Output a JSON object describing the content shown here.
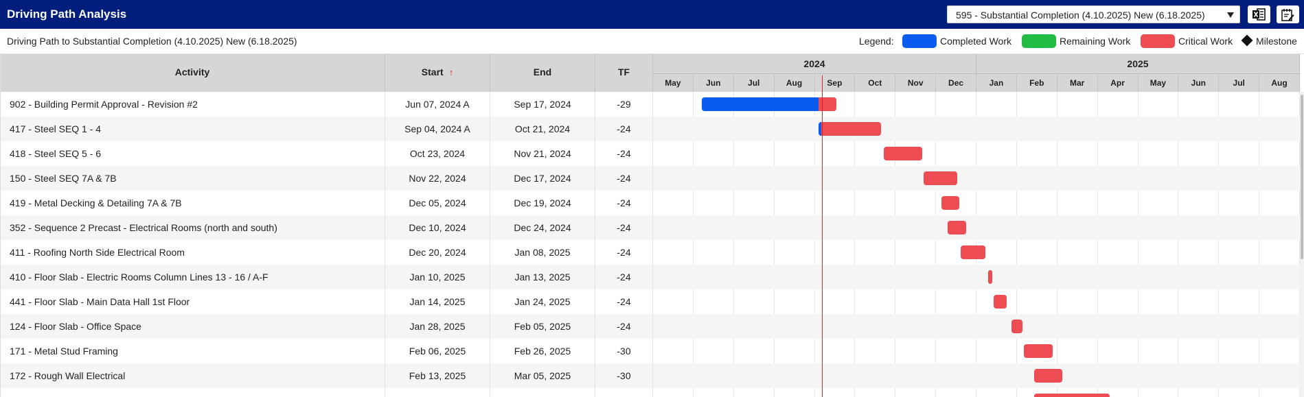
{
  "header": {
    "title": "Driving Path Analysis",
    "scenario_selected": "595 - Substantial Completion (4.10.2025) New (6.18.2025)",
    "excel_icon": "excel-export-icon",
    "notes_icon": "edit-notes-icon"
  },
  "subheader": {
    "path_label": "Driving Path to Substantial Completion (4.10.2025) New (6.18.2025)",
    "legend_label": "Legend:",
    "legend": [
      {
        "label": "Completed Work",
        "color": "#0a5cf0"
      },
      {
        "label": "Remaining Work",
        "color": "#22bb44"
      },
      {
        "label": "Critical Work",
        "color": "#ec4c52"
      },
      {
        "label": "Milestone",
        "color": "#111111"
      }
    ]
  },
  "table": {
    "columns": {
      "activity": "Activity",
      "start": "Start",
      "end": "End",
      "tf": "TF"
    },
    "sort_indicator": "↑",
    "rows": [
      {
        "activity": "902 - Building Permit Approval - Revision #2",
        "start": "Jun 07, 2024 A",
        "end": "Sep 17, 2024",
        "tf": "-29",
        "start_date": "2024-06-07",
        "end_date": "2024-09-17",
        "completed_until": "2024-09-04"
      },
      {
        "activity": "417 - Steel SEQ 1 - 4",
        "start": "Sep 04, 2024 A",
        "end": "Oct 21, 2024",
        "tf": "-24",
        "start_date": "2024-09-04",
        "end_date": "2024-10-21",
        "completed_until": "2024-09-06"
      },
      {
        "activity": "418 - Steel SEQ 5 - 6",
        "start": "Oct 23, 2024",
        "end": "Nov 21, 2024",
        "tf": "-24",
        "start_date": "2024-10-23",
        "end_date": "2024-11-21"
      },
      {
        "activity": "150 - Steel SEQ 7A & 7B",
        "start": "Nov 22, 2024",
        "end": "Dec 17, 2024",
        "tf": "-24",
        "start_date": "2024-11-22",
        "end_date": "2024-12-17"
      },
      {
        "activity": "419 - Metal Decking & Detailing 7A & 7B",
        "start": "Dec 05, 2024",
        "end": "Dec 19, 2024",
        "tf": "-24",
        "start_date": "2024-12-05",
        "end_date": "2024-12-19"
      },
      {
        "activity": "352 - Sequence 2 Precast - Electrical Rooms (north and south)",
        "start": "Dec 10, 2024",
        "end": "Dec 24, 2024",
        "tf": "-24",
        "start_date": "2024-12-10",
        "end_date": "2024-12-24"
      },
      {
        "activity": "411 - Roofing North Side Electrical Room",
        "start": "Dec 20, 2024",
        "end": "Jan 08, 2025",
        "tf": "-24",
        "start_date": "2024-12-20",
        "end_date": "2025-01-08"
      },
      {
        "activity": "410 - Floor Slab - Electric Rooms Column Lines 13 - 16 / A-F",
        "start": "Jan 10, 2025",
        "end": "Jan 13, 2025",
        "tf": "-24",
        "start_date": "2025-01-10",
        "end_date": "2025-01-13"
      },
      {
        "activity": "441 - Floor Slab - Main Data Hall 1st Floor",
        "start": "Jan 14, 2025",
        "end": "Jan 24, 2025",
        "tf": "-24",
        "start_date": "2025-01-14",
        "end_date": "2025-01-24"
      },
      {
        "activity": "124 - Floor Slab - Office Space",
        "start": "Jan 28, 2025",
        "end": "Feb 05, 2025",
        "tf": "-24",
        "start_date": "2025-01-28",
        "end_date": "2025-02-05"
      },
      {
        "activity": "171 - Metal Stud Framing",
        "start": "Feb 06, 2025",
        "end": "Feb 26, 2025",
        "tf": "-30",
        "start_date": "2025-02-06",
        "end_date": "2025-02-26"
      },
      {
        "activity": "172 - Rough Wall Electrical",
        "start": "Feb 13, 2025",
        "end": "Mar 05, 2025",
        "tf": "-30",
        "start_date": "2025-02-13",
        "end_date": "2025-03-05"
      },
      {
        "activity": "",
        "start": "",
        "end": "",
        "tf": "",
        "start_date": "2025-02-13",
        "end_date": "2025-04-10"
      }
    ]
  },
  "gantt": {
    "years": [
      {
        "label": "2024",
        "months": 8
      },
      {
        "label": "2025",
        "months": 8
      }
    ],
    "months": [
      "May",
      "Jun",
      "Jul",
      "Aug",
      "Sep",
      "Oct",
      "Nov",
      "Dec",
      "Jan",
      "Feb",
      "Mar",
      "Apr",
      "May",
      "Jun",
      "Jul",
      "Aug"
    ],
    "range_start": "2024-05-01",
    "range_end": "2025-09-01",
    "data_date": "2024-09-10"
  }
}
